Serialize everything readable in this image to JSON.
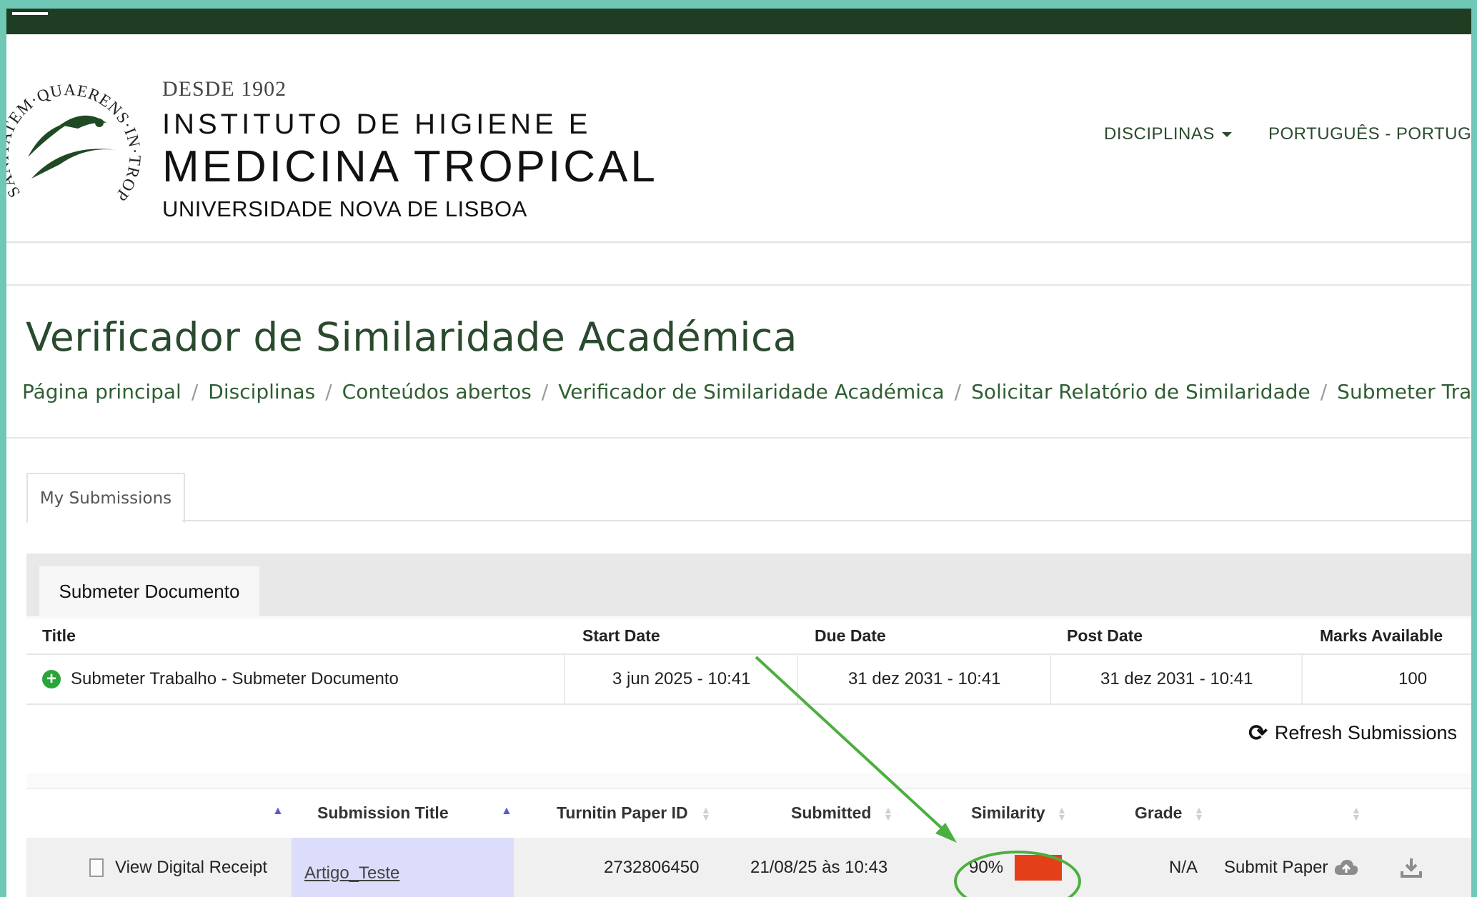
{
  "header": {
    "since": "DESDE 1902",
    "institute_line1": "INSTITUTO DE HIGIENE E",
    "institute_line2": "MEDICINA TROPICAL",
    "institute_line3": "UNIVERSIDADE NOVA DE LISBOA",
    "emblem_motto": "SANITATEM·QUAERENS·IN·TROPICOS",
    "nav": {
      "disciplinas": "DISCIPLINAS",
      "language": "PORTUGUÊS - PORTUGAL ("
    }
  },
  "page": {
    "title": "Verificador de Similaridade Académica",
    "breadcrumb": [
      "Página principal",
      "Disciplinas",
      "Conteúdos abertos",
      "Verificador de Similaridade Académica",
      "Solicitar Relatório de Similaridade",
      "Submeter Trabalho"
    ]
  },
  "tabs": {
    "my_submissions": "My Submissions",
    "submeter_documento": "Submeter Documento"
  },
  "assignment_table": {
    "headers": [
      "Title",
      "Start Date",
      "Due Date",
      "Post Date",
      "Marks Available"
    ],
    "row": {
      "title": "Submeter Trabalho - Submeter Documento",
      "start_date": "3 jun 2025 - 10:41",
      "due_date": "31 dez 2031 - 10:41",
      "post_date": "31 dez 2031 - 10:41",
      "marks": "100"
    }
  },
  "refresh": {
    "label": "Refresh Submissions"
  },
  "submissions_table": {
    "headers": {
      "submission_title": "Submission Title",
      "paper_id": "Turnitin Paper ID",
      "submitted": "Submitted",
      "similarity": "Similarity",
      "grade": "Grade"
    },
    "row": {
      "receipt": "View Digital Receipt",
      "title": "Artigo_Teste",
      "paper_id": "2732806450",
      "submitted": "21/08/25 às 10:43",
      "similarity": "90%",
      "grade": "N/A",
      "submit_paper": "Submit Paper"
    }
  },
  "colors": {
    "brand_dark_green": "#1f3d22",
    "similarity_bar": "#e3401a",
    "annotation_green": "#4caf3f",
    "frame_teal": "#6fc7b5"
  },
  "icons": [
    "menu-icon",
    "caret-down-icon",
    "plus-circle-icon",
    "refresh-icon",
    "sort-icon",
    "document-icon",
    "cloud-upload-icon",
    "download-icon"
  ]
}
